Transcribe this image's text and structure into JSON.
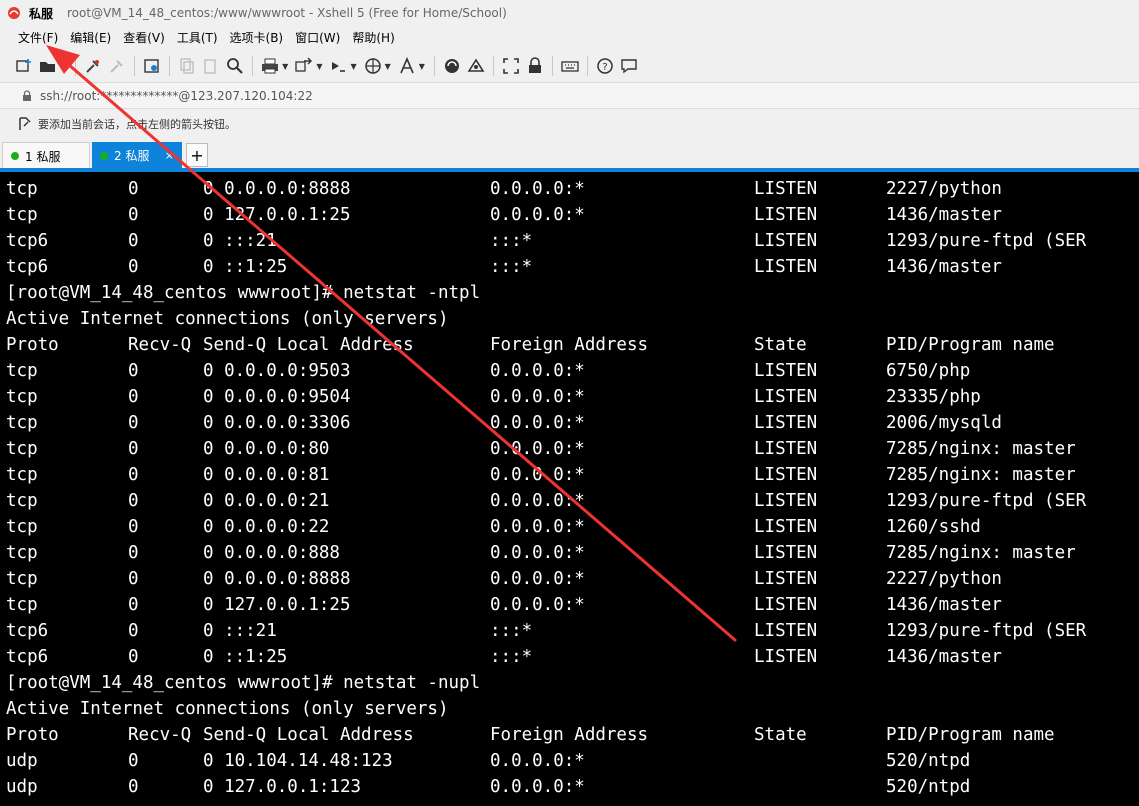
{
  "window": {
    "app_name": "私服",
    "title": "root@VM_14_48_centos:/www/wwwroot - Xshell 5 (Free for Home/School)"
  },
  "menu": [
    "文件(F)",
    "编辑(E)",
    "查看(V)",
    "工具(T)",
    "选项卡(B)",
    "窗口(W)",
    "帮助(H)"
  ],
  "address": {
    "url": "ssh://root:*************@123.207.120.104:22"
  },
  "hint": {
    "text": "要添加当前会话，点击左侧的箭头按钮。"
  },
  "tabs": [
    {
      "label": "1 私服",
      "active": false
    },
    {
      "label": "2 私服",
      "active": true,
      "close": "×"
    }
  ],
  "tab_add_label": "+",
  "terminal": {
    "lines": [
      {
        "kind": "row",
        "c": [
          "tcp",
          "0",
          "0 0.0.0.0:8888",
          "0.0.0.0:*",
          "LISTEN",
          "2227/python"
        ]
      },
      {
        "kind": "row",
        "c": [
          "tcp",
          "0",
          "0 127.0.0.1:25",
          "0.0.0.0:*",
          "LISTEN",
          "1436/master"
        ]
      },
      {
        "kind": "row",
        "c": [
          "tcp6",
          "0",
          "0 :::21",
          ":::*",
          "LISTEN",
          "1293/pure-ftpd (SER"
        ]
      },
      {
        "kind": "row",
        "c": [
          "tcp6",
          "0",
          "0 ::1:25",
          ":::*",
          "LISTEN",
          "1436/master"
        ]
      },
      {
        "kind": "text",
        "text": "[root@VM_14_48_centos wwwroot]# netstat -ntpl"
      },
      {
        "kind": "text",
        "text": "Active Internet connections (only servers)"
      },
      {
        "kind": "row",
        "c": [
          "Proto",
          "Recv-Q",
          "Send-Q Local Address",
          "Foreign Address",
          "State",
          "PID/Program name"
        ]
      },
      {
        "kind": "row",
        "c": [
          "tcp",
          "0",
          "0 0.0.0.0:9503",
          "0.0.0.0:*",
          "LISTEN",
          "6750/php"
        ]
      },
      {
        "kind": "row",
        "c": [
          "tcp",
          "0",
          "0 0.0.0.0:9504",
          "0.0.0.0:*",
          "LISTEN",
          "23335/php"
        ]
      },
      {
        "kind": "row",
        "c": [
          "tcp",
          "0",
          "0 0.0.0.0:3306",
          "0.0.0.0:*",
          "LISTEN",
          "2006/mysqld"
        ]
      },
      {
        "kind": "row",
        "c": [
          "tcp",
          "0",
          "0 0.0.0.0:80",
          "0.0.0.0:*",
          "LISTEN",
          "7285/nginx: master"
        ]
      },
      {
        "kind": "row",
        "c": [
          "tcp",
          "0",
          "0 0.0.0.0:81",
          "0.0.0.0:*",
          "LISTEN",
          "7285/nginx: master"
        ]
      },
      {
        "kind": "row",
        "c": [
          "tcp",
          "0",
          "0 0.0.0.0:21",
          "0.0.0.0:*",
          "LISTEN",
          "1293/pure-ftpd (SER"
        ]
      },
      {
        "kind": "row",
        "c": [
          "tcp",
          "0",
          "0 0.0.0.0:22",
          "0.0.0.0:*",
          "LISTEN",
          "1260/sshd"
        ]
      },
      {
        "kind": "row",
        "c": [
          "tcp",
          "0",
          "0 0.0.0.0:888",
          "0.0.0.0:*",
          "LISTEN",
          "7285/nginx: master"
        ]
      },
      {
        "kind": "row",
        "c": [
          "tcp",
          "0",
          "0 0.0.0.0:8888",
          "0.0.0.0:*",
          "LISTEN",
          "2227/python"
        ]
      },
      {
        "kind": "row",
        "c": [
          "tcp",
          "0",
          "0 127.0.0.1:25",
          "0.0.0.0:*",
          "LISTEN",
          "1436/master"
        ]
      },
      {
        "kind": "row",
        "c": [
          "tcp6",
          "0",
          "0 :::21",
          ":::*",
          "LISTEN",
          "1293/pure-ftpd (SER"
        ]
      },
      {
        "kind": "row",
        "c": [
          "tcp6",
          "0",
          "0 ::1:25",
          ":::*",
          "LISTEN",
          "1436/master"
        ]
      },
      {
        "kind": "text",
        "text": "[root@VM_14_48_centos wwwroot]# netstat -nupl"
      },
      {
        "kind": "text",
        "text": "Active Internet connections (only servers)"
      },
      {
        "kind": "row",
        "c": [
          "Proto",
          "Recv-Q",
          "Send-Q Local Address",
          "Foreign Address",
          "State",
          "PID/Program name"
        ]
      },
      {
        "kind": "row",
        "c": [
          "udp",
          "0",
          "0 10.104.14.48:123",
          "0.0.0.0:*",
          "",
          "520/ntpd"
        ]
      },
      {
        "kind": "row",
        "c": [
          "udp",
          "0",
          "0 127.0.0.1:123",
          "0.0.0.0:*",
          "",
          "520/ntpd"
        ]
      }
    ]
  },
  "colors": {
    "accent": "#0d83d9",
    "annotation_arrow": "#ee3333",
    "terminal_bg": "#000000",
    "terminal_fg": "#ffffff"
  },
  "icons": [
    "new-session-icon",
    "open-folder-icon",
    "connect-icon",
    "disconnect-icon",
    "properties-icon",
    "copy-icon",
    "paste-icon",
    "find-icon",
    "print-icon",
    "transfer-icon",
    "script-icon",
    "globe-icon",
    "font-icon",
    "xftp-icon",
    "xshell-icon",
    "fullscreen-icon",
    "lock-screen-icon",
    "keyboard-icon",
    "help-icon",
    "chat-icon"
  ]
}
